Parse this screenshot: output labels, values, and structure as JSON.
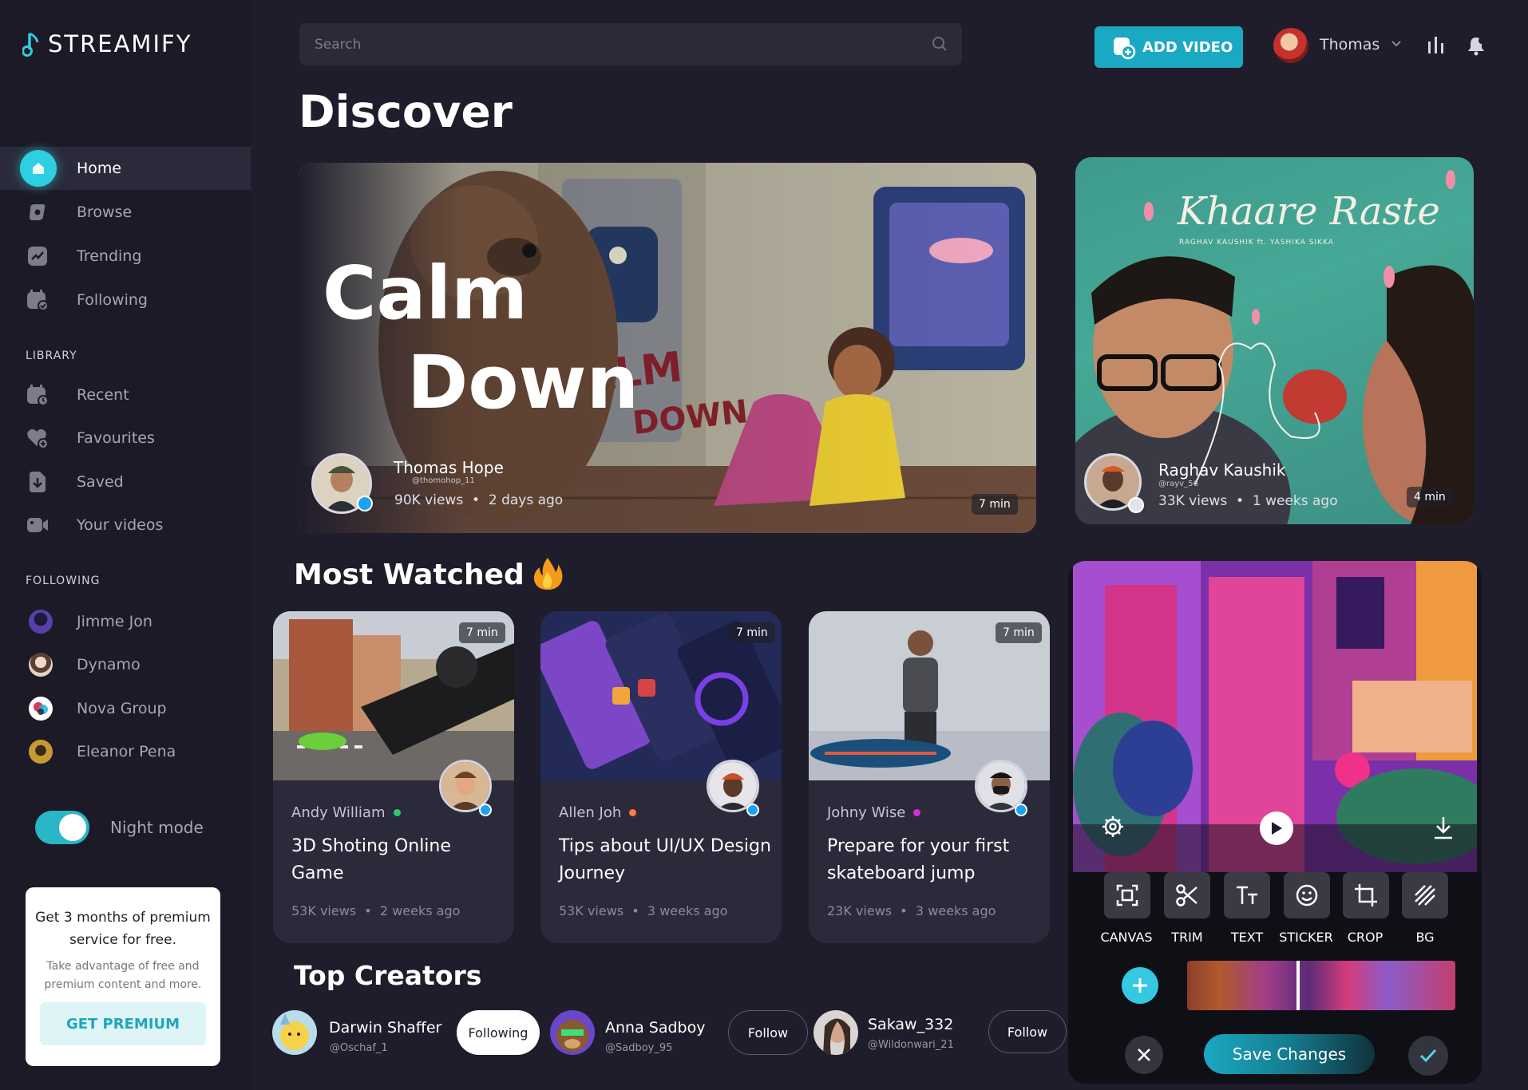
{
  "app": {
    "name": "STREAMIFY"
  },
  "sidebar": {
    "nav": [
      {
        "label": "Home",
        "icon": "home-icon",
        "active": true
      },
      {
        "label": "Browse",
        "icon": "browse-icon"
      },
      {
        "label": "Trending",
        "icon": "trending-icon"
      },
      {
        "label": "Following",
        "icon": "following-icon"
      }
    ],
    "library_label": "LIBRARY",
    "library": [
      {
        "label": "Recent",
        "icon": "calendar-icon"
      },
      {
        "label": "Favourites",
        "icon": "heart-icon"
      },
      {
        "label": "Saved",
        "icon": "download-icon"
      },
      {
        "label": "Your videos",
        "icon": "camera-icon"
      }
    ],
    "following_label": "FOLLOWING",
    "following": [
      {
        "name": "Jimme Jon",
        "color": "#5a3fa8"
      },
      {
        "name": "Dynamo",
        "color": "#e6d2c4"
      },
      {
        "name": "Nova Group",
        "color": "#ffffff"
      },
      {
        "name": "Eleanor Pena",
        "color": "#c79a35"
      }
    ],
    "night_mode_label": "Night mode",
    "night_mode": true,
    "promo": {
      "title": "Get 3 months of premium service for free.",
      "subtitle": "Take advantage of free and premium content and more.",
      "button": "GET PREMIUM"
    }
  },
  "header": {
    "search_placeholder": "Search",
    "add_video": "ADD VIDEO",
    "user_name": "Thomas"
  },
  "page_title": "Discover",
  "hero": {
    "title_line1": "Calm",
    "title_line2": "Down",
    "creator": "Thomas Hope",
    "handle": "@thomohop_11",
    "views": "90K views",
    "age": "2 days ago",
    "duration": "7 min"
  },
  "side_feature": {
    "song_title": "Khaare Raste",
    "song_credits": "RAGHAV KAUSHIK ft. YASHIKA SIKKA",
    "creator": "Raghav Kaushik",
    "handle": "@rayv_56",
    "views": "33K views",
    "age": "1 weeks ago",
    "duration": "4 min"
  },
  "most_watched": {
    "title": "Most Watched",
    "cards": [
      {
        "author": "Andy William",
        "dot_color": "#2ecc71",
        "title": "3D Shoting Online Game",
        "views": "53K views",
        "age": "2 weeks ago",
        "duration": "7 min"
      },
      {
        "author": "Allen Joh",
        "dot_color": "#ff7a3d",
        "title": "Tips about UI/UX Design Journey",
        "views": "53K views",
        "age": "3  weeks ago",
        "duration": "7 min"
      },
      {
        "author": "Johny Wise",
        "dot_color": "#d62bd6",
        "title": "Prepare for your first skateboard jump",
        "views": "23K views",
        "age": "3 weeks ago",
        "duration": "7 min"
      }
    ]
  },
  "editor": {
    "tools": [
      "CANVAS",
      "TRIM",
      "TEXT",
      "STICKER",
      "CROP",
      "BG"
    ],
    "save": "Save Changes"
  },
  "top_creators": {
    "title": "Top Creators",
    "items": [
      {
        "name": "Darwin Shaffer",
        "handle": "@Oschaf_1",
        "button": "Following"
      },
      {
        "name": "Anna Sadboy",
        "handle": "@Sadboy_95",
        "button": "Follow"
      },
      {
        "name": "Sakaw_332",
        "handle": "@Wildonwari_21",
        "button": "Follow"
      }
    ]
  }
}
